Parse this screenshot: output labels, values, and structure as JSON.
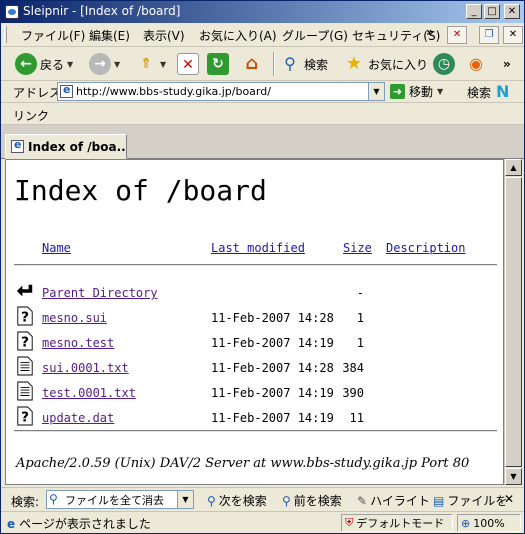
{
  "window": {
    "title": "Sleipnir - [Index of /board]"
  },
  "menu": {
    "items": [
      "ファイル(F)",
      "編集(E)",
      "表示(V)",
      "お気に入り(A)",
      "グループ(G)",
      "セキュリティ(S)"
    ],
    "more": "»"
  },
  "toolbar": {
    "back_label": "戻る",
    "search_label": "検索",
    "favorites_label": "お気に入り",
    "more": "»"
  },
  "address_bar": {
    "label": "アドレス",
    "url": "http://www.bbs-study.gika.jp/board/",
    "go_label": "移動",
    "search_label": "検索"
  },
  "links_bar": {
    "label": "リンク"
  },
  "tabs": [
    {
      "label": "Index of /boa..."
    }
  ],
  "page": {
    "heading": "Index of /board",
    "columns": {
      "name": "Name",
      "modified": "Last modified",
      "size": "Size",
      "description": "Description"
    },
    "rows": [
      {
        "icon": "back-arrow-icon",
        "name": "Parent Directory",
        "modified": "",
        "size": "-"
      },
      {
        "icon": "unknown-file-icon",
        "name": "mesno.sui",
        "modified": "11-Feb-2007 14:28",
        "size": "1"
      },
      {
        "icon": "unknown-file-icon",
        "name": "mesno.test",
        "modified": "11-Feb-2007 14:19",
        "size": "1"
      },
      {
        "icon": "text-file-icon",
        "name": "sui.0001.txt",
        "modified": "11-Feb-2007 14:28",
        "size": "384"
      },
      {
        "icon": "text-file-icon",
        "name": "test.0001.txt",
        "modified": "11-Feb-2007 14:19",
        "size": "390"
      },
      {
        "icon": "unknown-file-icon",
        "name": "update.dat",
        "modified": "11-Feb-2007 14:19",
        "size": "11"
      }
    ],
    "server_signature": "Apache/2.0.59 (Unix) DAV/2 Server at www.bbs-study.gika.jp Port 80"
  },
  "find_bar": {
    "label": "検索:",
    "select_value": "ファイルを全て消去",
    "next_label": "次を検索",
    "prev_label": "前を検索",
    "highlight_label": "ハイライト",
    "file_label": "ファイルを"
  },
  "status_bar": {
    "text": "ページが表示されました",
    "mode": "デフォルトモード",
    "zoom": "100%"
  }
}
